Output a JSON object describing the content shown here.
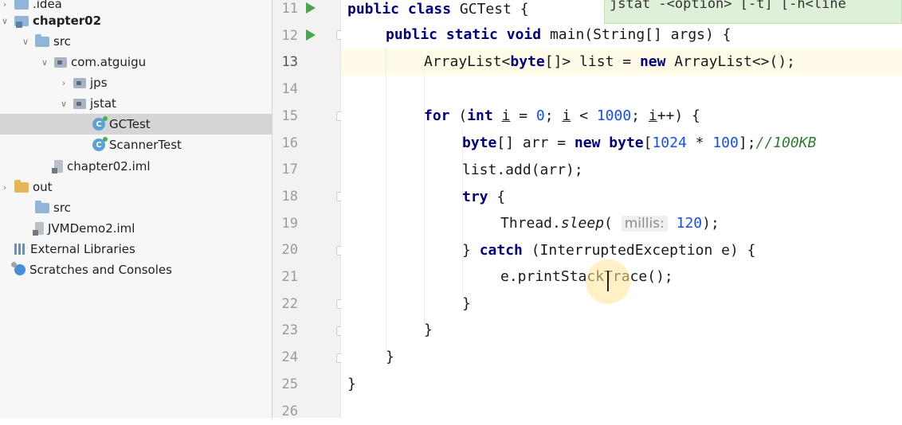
{
  "project_tree": {
    "items": [
      {
        "label": ".idea",
        "icon": "folder-icon",
        "arrow": "right",
        "indent": 0
      },
      {
        "label": "chapter02",
        "icon": "module-folder-icon",
        "arrow": "down",
        "indent": 0
      },
      {
        "label": "src",
        "icon": "folder-icon",
        "arrow": "down",
        "indent": 1
      },
      {
        "label": "com.atguigu",
        "icon": "package-icon",
        "arrow": "down",
        "indent": 2
      },
      {
        "label": "jps",
        "icon": "package-icon",
        "arrow": "right",
        "indent": 3
      },
      {
        "label": "jstat",
        "icon": "package-icon",
        "arrow": "down",
        "indent": 3
      },
      {
        "label": "GCTest",
        "icon": "java-class-icon",
        "arrow": "",
        "indent": 4,
        "selected": true
      },
      {
        "label": "ScannerTest",
        "icon": "java-class-icon",
        "arrow": "",
        "indent": 4
      },
      {
        "label": "chapter02.iml",
        "icon": "iml-file-icon",
        "arrow": "",
        "indent": 2
      },
      {
        "label": "out",
        "icon": "excluded-folder-icon",
        "arrow": "right",
        "indent": 0
      },
      {
        "label": "src",
        "icon": "folder-icon",
        "arrow": "",
        "indent": 1
      },
      {
        "label": "JVMDemo2.iml",
        "icon": "iml-file-icon",
        "arrow": "",
        "indent": 1
      },
      {
        "label": "External Libraries",
        "icon": "libraries-icon",
        "arrow": "",
        "indent": 0
      },
      {
        "label": "Scratches and Consoles",
        "icon": "scratches-icon",
        "arrow": "",
        "indent": 0
      }
    ]
  },
  "editor": {
    "line_numbers": [
      "11",
      "12",
      "13",
      "14",
      "15",
      "16",
      "17",
      "18",
      "19",
      "20",
      "21",
      "22",
      "23",
      "24",
      "25",
      "26"
    ],
    "current_line": "13",
    "popup_text": "jstat -<option> [-t] [-h<line",
    "lines": {
      "l11": {
        "kw1": "public",
        "kw2": "class",
        "rest": " GCTest {"
      },
      "l12": {
        "kw1": "public",
        "kw2": "static",
        "kw3": "void",
        "rest": " main(String[] args) {"
      },
      "l13": {
        "a": "ArrayList<",
        "kw1": "byte",
        "b": "[]> list = ",
        "kw2": "new",
        "c": " ArrayList<>();"
      },
      "l15": {
        "kw1": "for",
        "a": " (",
        "kw2": "int",
        "b": " ",
        "v1": "i",
        "c": " = ",
        "n1": "0",
        "d": "; ",
        "v2": "i",
        "e": " < ",
        "n2": "1000",
        "f": "; ",
        "v3": "i",
        "g": "++) {"
      },
      "l16": {
        "kw1": "byte",
        "a": "[] arr = ",
        "kw2": "new",
        "b": " ",
        "kw3": "byte",
        "c": "[",
        "n1": "1024",
        "d": " * ",
        "n2": "100",
        "e": "];",
        "comment": "//100KB"
      },
      "l17": {
        "text": "list.add(arr);"
      },
      "l18": {
        "kw1": "try",
        "rest": " {"
      },
      "l19": {
        "a": "Thread.",
        "m": "sleep",
        "b": "( ",
        "hint": "millis:",
        "c": " ",
        "n1": "120",
        "d": ");"
      },
      "l20": {
        "a": "} ",
        "kw1": "catch",
        "b": " (InterruptedException e) {"
      },
      "l21": {
        "text": "e.printStackTrace();"
      },
      "l22": {
        "text": "}"
      },
      "l23": {
        "text": "}"
      },
      "l24": {
        "text": "}"
      },
      "l25": {
        "text": "}"
      }
    }
  },
  "colors": {
    "keyword": "#000080",
    "number": "#1750eb",
    "comment": "#2e7d32",
    "run_icon": "#4ea24e"
  }
}
